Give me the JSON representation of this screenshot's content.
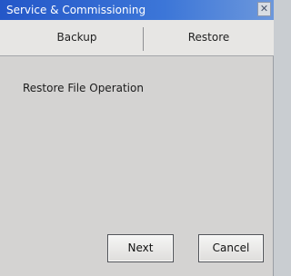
{
  "window": {
    "title": "Service & Commissioning",
    "close_glyph": "✕"
  },
  "tabs": [
    {
      "label": "Backup",
      "selected": false
    },
    {
      "label": "Restore",
      "selected": true
    }
  ],
  "content": {
    "heading": "Restore File Operation"
  },
  "buttons": {
    "next_label": "Next",
    "cancel_label": "Cancel"
  },
  "colors": {
    "titlebar": "#2457c8",
    "window_bg": "#d4d3d2",
    "tab_strip_bg": "#e7e6e4"
  }
}
